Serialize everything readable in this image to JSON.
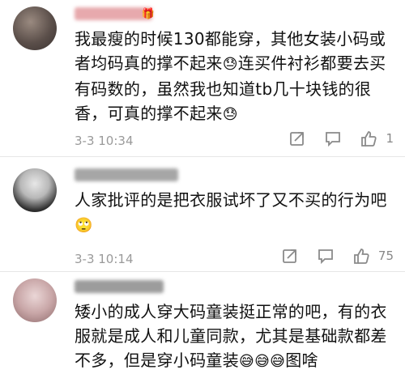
{
  "comments": [
    {
      "text": "我最瘦的时候130都能穿，其他女装小码或者均码真的撑不起来",
      "text_tail_1": "连买件衬衫都要去买有码数的，虽然我也知道tb几十块钱的很香，可真的撑不起来",
      "timestamp": "3-3 10:34",
      "like_count": "1",
      "emoji": "😓",
      "badge_icon": "gift-icon"
    },
    {
      "text": "人家批评的是把衣服试坏了又不买的行为吧",
      "emoji_line": "🙄",
      "timestamp": "3-3 10:14",
      "like_count": "75"
    },
    {
      "text": "矮小的成人穿大码童装挺正常的吧，有的衣服就是成人和儿童同款，尤其是基础款都差不多，但是穿小码童装",
      "emoji_tail": "😅😅😅",
      "text_tail": "图啥"
    }
  ],
  "colors": {
    "divider": "#e6e6e6",
    "meta_text": "#9a9a9a",
    "body_text": "#111111"
  }
}
